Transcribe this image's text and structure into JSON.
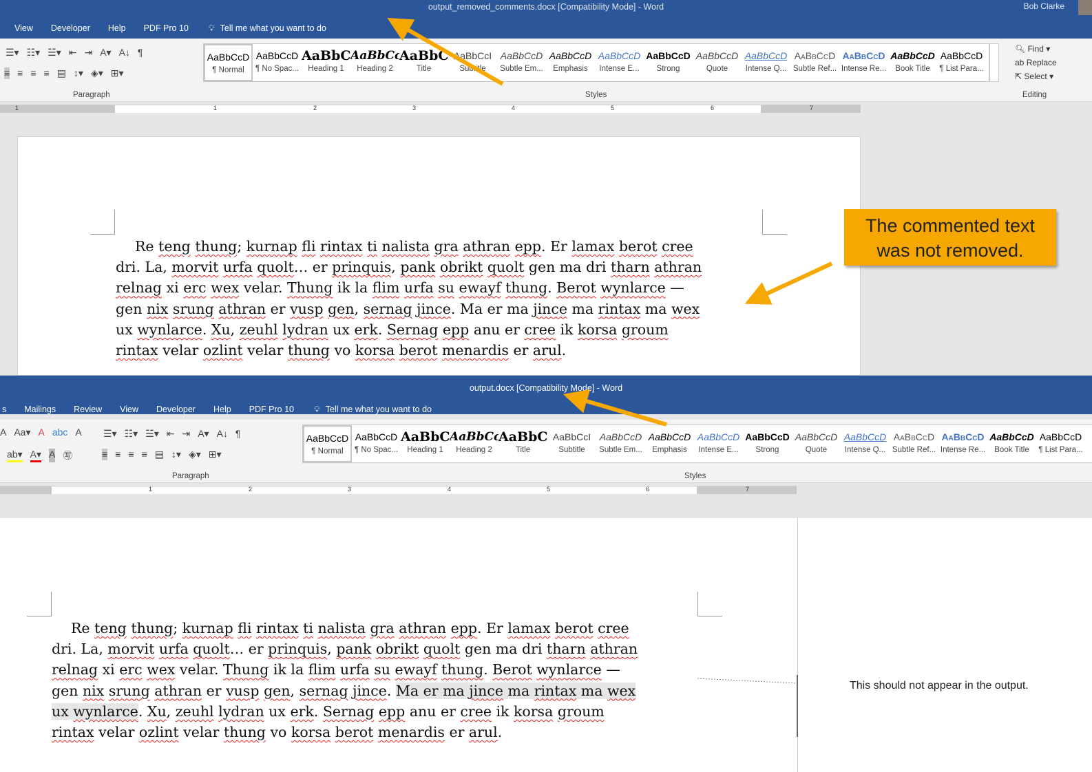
{
  "top": {
    "title": "output_removed_comments.docx [Compatibility Mode]  -  Word",
    "user": "Bob Clarke",
    "tabs": [
      "View",
      "Developer",
      "Help",
      "PDF Pro 10"
    ],
    "tell_me": "Tell me what you want to do",
    "paragraph_label": "Paragraph",
    "styles_label": "Styles",
    "editing_label": "Editing",
    "find": "Find",
    "replace": "Replace",
    "select": "Select",
    "lines": [
      [
        {
          "t": "Re teng thung; kurnap fli rintax ti nalista gra athran epp. Er lamax berot cree"
        }
      ],
      [
        {
          "t": "dri. La, morvit urfa quolt… er prinquis, pank obrikt quolt gen ma dri tharn athran"
        }
      ],
      [
        {
          "t": "relnag xi erc wex velar. Thung ik la flim urfa su ewayf thung. Berot wynlarce —"
        }
      ],
      [
        {
          "t": "gen nix srung athran er vusp gen, sernag jince. Ma er ma jince ma rintax ma wex"
        }
      ],
      [
        {
          "t": "ux wynlarce. Xu, zeuhl lydran ux erk. Sernag epp anu er cree ik korsa groum"
        }
      ],
      [
        {
          "t": "rintax velar ozlint velar thung vo korsa berot menardis er arul."
        }
      ]
    ]
  },
  "callout": {
    "line1": "The commented text",
    "line2": "was not removed.",
    "color": "#f6a800"
  },
  "bottom": {
    "title": "output.docx [Compatibility Mode]  -  Word",
    "tabs": [
      "s",
      "Mailings",
      "Review",
      "View",
      "Developer",
      "Help",
      "PDF Pro 10"
    ],
    "tell_me": "Tell me what you want to do",
    "paragraph_label": "Paragraph",
    "styles_label": "Styles",
    "comment": "This should not appear in the output.",
    "lines": [
      [
        {
          "t": "Re teng thung; kurnap fli rintax ti nalista gra athran epp. Er lamax berot cree"
        }
      ],
      [
        {
          "t": "dri. La, morvit urfa quolt… er prinquis, pank obrikt quolt gen ma dri tharn athran"
        }
      ],
      [
        {
          "t": "relnag xi erc wex velar. Thung ik la flim urfa su ewayf thung. Berot wynlarce —"
        }
      ],
      [
        {
          "t": "gen nix srung athran er vusp gen, sernag jince. "
        },
        {
          "t": "Ma er ma jince ma rintax ma wex",
          "hl": true
        }
      ],
      [
        {
          "t": "ux wynlarce",
          "hl": true
        },
        {
          "t": ". Xu, zeuhl lydran ux erk. Sernag epp anu er cree ik korsa groum"
        }
      ],
      [
        {
          "t": "rintax velar ozlint velar thung vo korsa berot menardis er arul."
        }
      ]
    ]
  },
  "styles": [
    {
      "preview": "AaBbCcD",
      "name": "¶ Normal",
      "css": "font-size:14px"
    },
    {
      "preview": "AaBbCcD",
      "name": "¶ No Spac...",
      "css": "font-size:14px"
    },
    {
      "preview": "AaBbC(",
      "name": "Heading 1",
      "css": "font-family:'DejaVu Serif',serif;font-weight:bold;font-size:19px"
    },
    {
      "preview": "AaBbCc",
      "name": "Heading 2",
      "css": "font-family:'DejaVu Serif',serif;font-weight:bold;font-style:italic;font-size:17px"
    },
    {
      "preview": "AaBbC(",
      "name": "Title",
      "css": "font-family:'DejaVu Serif',serif;font-weight:bold;font-size:19px"
    },
    {
      "preview": "AaBbCcI",
      "name": "Subtitle",
      "css": "font-size:14px;color:#444"
    },
    {
      "preview": "AaBbCcD",
      "name": "Subtle Em...",
      "css": "font-style:italic;color:#444"
    },
    {
      "preview": "AaBbCcD",
      "name": "Emphasis",
      "css": "font-style:italic"
    },
    {
      "preview": "AaBbCcD",
      "name": "Intense E...",
      "css": "font-style:italic;color:#4472c4"
    },
    {
      "preview": "AaBbCcD",
      "name": "Strong",
      "css": "font-weight:bold"
    },
    {
      "preview": "AaBbCcD",
      "name": "Quote",
      "css": "font-style:italic;color:#444"
    },
    {
      "preview": "AaBbCcD",
      "name": "Intense Q...",
      "css": "font-style:italic;color:#4472c4;text-decoration:underline"
    },
    {
      "preview": "AaBbCcD",
      "name": "Subtle Ref...",
      "css": "font-variant:small-caps;color:#555"
    },
    {
      "preview": "AaBbCcD",
      "name": "Intense Re...",
      "css": "font-variant:small-caps;font-weight:bold;color:#4472c4"
    },
    {
      "preview": "AaBbCcD",
      "name": "Book Title",
      "css": "font-weight:bold;font-style:italic"
    },
    {
      "preview": "AaBbCcD",
      "name": "¶ List Para...",
      "css": "font-size:14px"
    }
  ],
  "ruler_numbers": [
    "1",
    "1",
    "2",
    "3",
    "4",
    "5",
    "6",
    "7"
  ],
  "colors": {
    "titlebar": "#2b579a",
    "arrow": "#f6a800",
    "spell": "#e02020"
  }
}
